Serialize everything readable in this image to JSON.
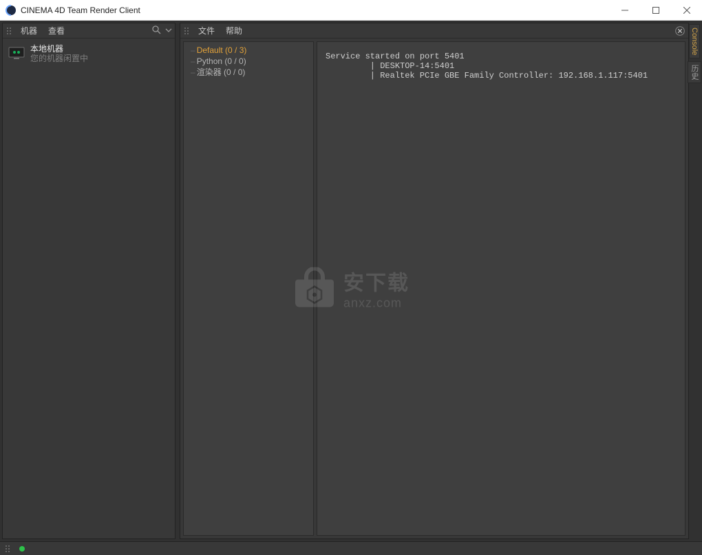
{
  "window": {
    "title": "CINEMA 4D Team Render Client"
  },
  "left_panel": {
    "menu1": "机器",
    "menu2": "查看",
    "machine": {
      "name": "本地机器",
      "status": "您的机器闲置中"
    }
  },
  "right_panel": {
    "menu1": "文件",
    "menu2": "帮助",
    "tree": {
      "item0": "Default (0 / 3)",
      "item1": "Python (0 / 0)",
      "item2": "渲染器 (0 / 0)"
    },
    "log_line0": "Service started on port 5401",
    "log_line1": "         | DESKTOP-14:5401",
    "log_line2": "         | Realtek PCIe GBE Family Controller: 192.168.1.117:5401"
  },
  "side_tabs": {
    "tab0": "Console",
    "tab1": "历史"
  },
  "watermark": {
    "big": "安下载",
    "small": "anxz.com"
  }
}
